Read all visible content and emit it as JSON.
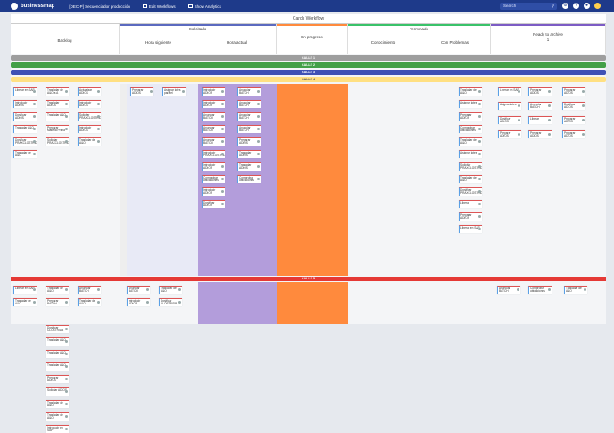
{
  "topbar": {
    "logo": "businessmap",
    "board": "[DEC-P] Secuenciador producción",
    "edit_workflows": "Edit Workflows",
    "show_analytics": "Show Analytics",
    "search_placeholder": "Search"
  },
  "board": {
    "title": "Cards Workflow"
  },
  "columns": {
    "backlog": "Backlog",
    "solicitado": "Solicitado",
    "hora_siguiente": "Hora siguiente",
    "hora_actual": "Hora actual",
    "en_progreso": "En progreso",
    "terminado": "Terminado",
    "conocimiento": "Conocimiento",
    "con_problemas": "Con Problemas",
    "ready": "Ready to archive",
    "ready_count": "1"
  },
  "lanes": {
    "calle1": "CALLE 1",
    "calle2": "CALLE 2",
    "calle3": "CALLE 3",
    "calle4": "CALLE 4",
    "calle5": "CALLE 5"
  },
  "colors": {
    "topbar": "#1e3a8a",
    "calle1": "#9e9e9e",
    "calle2": "#43a047",
    "calle3": "#3f51b5",
    "calle4": "#ffe082",
    "calle5": "#e53935",
    "hora_actual_bg": "#b39ddb",
    "en_progreso_bg": "#ff8a3d"
  },
  "cards_left": [
    "Liberar en SAP",
    "Trasladar de A&O a A",
    "Actualizar ADIOS",
    "Introducir ADIOS",
    "Trasladar ADIOS",
    "Introducir ADIOS",
    "Dosificar ADIOS",
    "Trasladar A&O",
    "Solicitar PRAXCLOSTRIDB",
    "Trasladar A&O",
    "Preparar Materia Prima",
    "Introducir ADIOS",
    "Dosificar PRAXCLOSTRIDB",
    "Solicitar PRAXCLOSTRIDB",
    "Trasladar de A&O",
    "Trasladar de A&O"
  ],
  "cards_mid": [
    "Trasladar de A&O a A",
    "Trasladar de A&O",
    "Liberar en SAP",
    "Dosificar CLOSTRIDB",
    "Trasladar A&O",
    "Trasladar A&O",
    "Trasladar A&O",
    "Preparar ADIOS",
    "Solicitar ADIOS",
    "Trasladar de A&O",
    "Trasladar de A&O",
    "Introducir en SAP"
  ],
  "cards_right": [
    "Trasladar de A&O",
    "Preparar ADIOS",
    "Comprobar ubicaciones",
    "Preparar ADIOS",
    "Comprobar ubicaciones",
    "Dosificar ADIOS",
    "Liberar",
    "Comprobar ubicaciones",
    "Introducir ADIOS",
    "Trasladar de A&O",
    "Dosificar ADIOS",
    "Trasladar ADIOS"
  ],
  "cards_sig": [
    "Preparar ADIOS",
    "Asignar lotes para el"
  ],
  "cards_act": [
    "Introducir ADIOS",
    "Introducir ADIOS",
    "Anunciar BATCH",
    "Anunciar BATCH",
    "Anunciar BATCH",
    "Introducir PRAXCLOSTRIDB",
    "Introducir ADIOS",
    "Comprobar ubicaciones",
    "Introducir ADIOS",
    "Dosificar ADIOS"
  ],
  "cards_act2": [
    "Anunciar BATCH",
    "Anunciar BATCH",
    "Anunciar BATCH",
    "Anunciar BATCH",
    "Preparar ADIOS",
    "Trasladar ADIOS",
    "Trasladar ADIOS",
    "Comprobar ubicaciones"
  ],
  "cards_prog": [
    "Anunciar BATCH"
  ],
  "cards_done": [
    "Trasladar de A&O",
    "Asignar lotes",
    "Preparar ADIOS",
    "Comprobar ubicaciones",
    "Trasladar de A&O",
    "Asignar lotes",
    "Solicitar PRAXCLOSTRIDB",
    "Trasladar de A&O",
    "Dosificar PRAXCLOSTRIDB",
    "Liberar",
    "Preparar ADIOS",
    "Liberar en SAP"
  ],
  "cards_done2": [
    "Liberar",
    "Asignar lotes",
    "Preparar ADIOS",
    "Asignar lotes",
    "Comprobar ubicaciones",
    "Comprobar ubicaciones",
    "Trasladar de A&O",
    "Solicitar PRAXCLOSTRIDB",
    "Dosificar ADIOS",
    "Trasladar de A&O",
    "Preparar ADIOS",
    "Preparar ADIOS"
  ],
  "cards_ready": [
    "Liberar en SAP",
    "Preparar ADIOS",
    "Preparar ADIOS",
    "Asignar lotes",
    "Anunciar BATCH",
    "Dosificar ADIOS",
    "Dosificar ADIOS",
    "Liberar",
    "Preparar ADIOS",
    "Preparar ADIOS",
    "Preparar ADIOS",
    "Preparar ADIOS"
  ],
  "calle5_cards": [
    "Liberar en SAP",
    "Trasladar de A&O",
    "Anunciar BATCH",
    "Anunciar BATCH",
    "Trasladar de A&O",
    "Dosificar CLOSTRIDB",
    "Dosificar CLOSTRIDB",
    "Dosificar ADIOS",
    "Anunciar BATCH",
    "Anunciar BATCH",
    "Comprobar ubicaciones",
    "Trasladar de A&O",
    "Trasladar de A&O",
    "Preparar BATCH",
    "Trasladar de A&O",
    "Introducir ADIOS",
    "Dosificar CLOSTRIDB",
    "Preparar ADIOS"
  ]
}
